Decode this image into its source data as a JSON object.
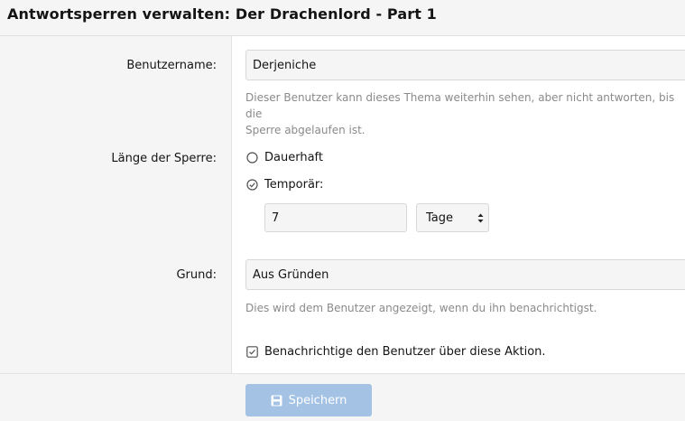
{
  "header": {
    "title": "Antwortsperren verwalten: Der Drachenlord - Part 1"
  },
  "username": {
    "label": "Benutzername:",
    "value": "Derjeniche",
    "hint_line1": "Dieser Benutzer kann dieses Thema weiterhin sehen, aber nicht antworten, bis die",
    "hint_line2": "Sperre abgelaufen ist."
  },
  "length": {
    "label": "Länge der Sperre:",
    "permanent_label": "Dauerhaft",
    "temporary_label": "Temporär:",
    "selected": "temporary",
    "amount": "7",
    "unit": "Tage"
  },
  "reason": {
    "label": "Grund:",
    "value": "Aus Gründen",
    "hint": "Dies wird dem Benutzer angezeigt, wenn du ihn benachrichtigst."
  },
  "notify": {
    "label": "Benachrichtige den Benutzer über diese Aktion.",
    "checked": true
  },
  "footer": {
    "save_label": "Speichern"
  },
  "colors": {
    "header_bg": "#f5f5f5",
    "button_bg": "#a3c2e4",
    "hint_text": "#8a8a8a"
  }
}
